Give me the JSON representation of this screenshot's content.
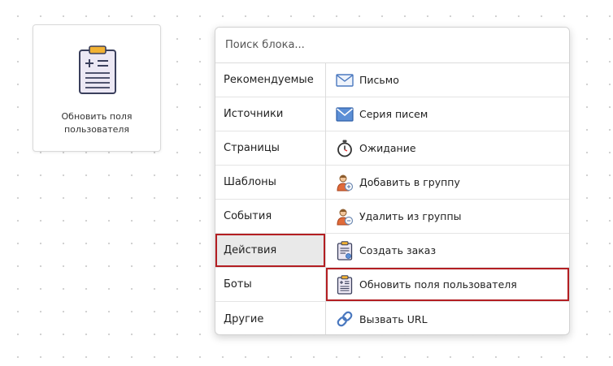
{
  "canvas_block": {
    "title": "Обновить поля пользователя",
    "icon": "clipboard-plus-equals-icon"
  },
  "picker": {
    "search_placeholder": "Поиск блока...",
    "categories": [
      {
        "label": "Рекомендуемые"
      },
      {
        "label": "Источники"
      },
      {
        "label": "Страницы"
      },
      {
        "label": "Шаблоны"
      },
      {
        "label": "События"
      },
      {
        "label": "Действия",
        "active": true
      },
      {
        "label": "Боты"
      },
      {
        "label": "Другие"
      }
    ],
    "items": [
      {
        "label": "Письмо",
        "icon": "envelope-icon"
      },
      {
        "label": "Серия писем",
        "icon": "envelope-large-icon"
      },
      {
        "label": "Ожидание",
        "icon": "stopwatch-icon"
      },
      {
        "label": "Добавить в группу",
        "icon": "user-add-icon"
      },
      {
        "label": "Удалить из группы",
        "icon": "user-remove-icon"
      },
      {
        "label": "Создать заказ",
        "icon": "clipboard-order-icon"
      },
      {
        "label": "Обновить поля пользователя",
        "icon": "clipboard-update-icon",
        "selected": true
      },
      {
        "label": "Вызвать URL",
        "icon": "link-icon"
      }
    ]
  },
  "colors": {
    "highlight_border": "#b31e22",
    "active_bg": "#e9e9e9",
    "clipboard_clip": "#f2b233",
    "clipboard_body": "#ece8f4",
    "envelope": "#5c8fd6"
  }
}
